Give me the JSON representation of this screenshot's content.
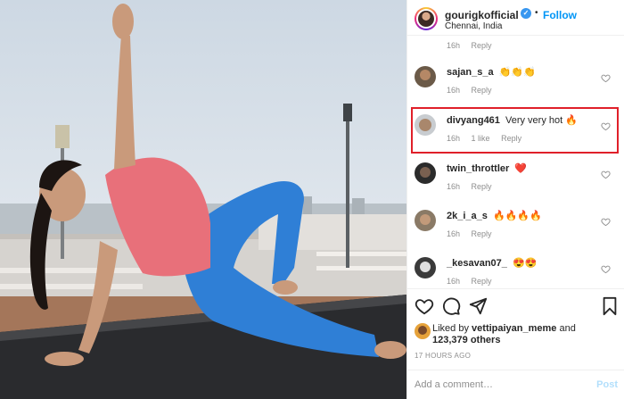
{
  "photo": {
    "alt_icon": "yoga-pose-photo"
  },
  "header": {
    "username": "gourigkofficial",
    "verified_glyph": "✓",
    "separator": "•",
    "follow_label": "Follow",
    "location": "Chennai, India"
  },
  "top_reply": {
    "time": "16h",
    "reply": "Reply"
  },
  "comments": [
    {
      "user": "sajan_s_a",
      "text": "👏👏👏",
      "time": "16h",
      "likes": "",
      "reply": "Reply"
    },
    {
      "user": "divyang461",
      "text": "Very very hot 🔥",
      "time": "16h",
      "likes": "1 like",
      "reply": "Reply"
    },
    {
      "user": "twin_throttler",
      "text": "❤️",
      "time": "16h",
      "likes": "",
      "reply": "Reply"
    },
    {
      "user": "2k_i_a_s",
      "text": "🔥🔥🔥🔥",
      "time": "16h",
      "likes": "",
      "reply": "Reply"
    },
    {
      "user": "_kesavan07_",
      "text": "😍😍",
      "time": "16h",
      "likes": "",
      "reply": "Reply"
    }
  ],
  "likes": {
    "prefix": "Liked by",
    "user": "vettipaiyan_meme",
    "and": "and",
    "count": "123,379 others"
  },
  "time_ago": "17 HOURS AGO",
  "add_comment": {
    "placeholder": "Add a comment…",
    "post_label": "Post"
  },
  "colors": {
    "accent": "#0095f6",
    "highlight": "#e0202a",
    "muted": "#8e8e8e"
  }
}
